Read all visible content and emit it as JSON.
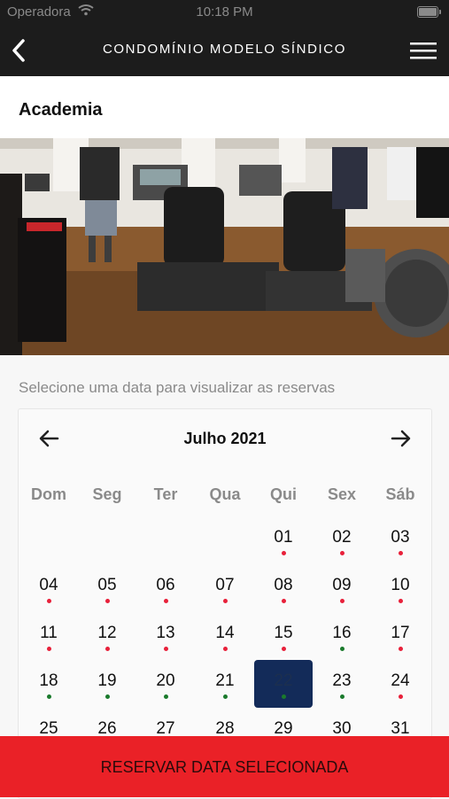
{
  "status_bar": {
    "carrier": "Operadora",
    "time": "10:18 PM"
  },
  "nav": {
    "title": "CONDOMÍNIO MODELO SÍNDICO",
    "back_icon": "chevron-left-icon",
    "menu_icon": "hamburger-menu-icon"
  },
  "page": {
    "section_title": "Academia",
    "hint": "Selecione uma data para visualizar as reservas"
  },
  "calendar": {
    "month_label": "Julho 2021",
    "weekdays": [
      "Dom",
      "Seg",
      "Ter",
      "Qua",
      "Qui",
      "Sex",
      "Sáb"
    ],
    "days": [
      {
        "label": "01",
        "status": "unavailable"
      },
      {
        "label": "02",
        "status": "unavailable"
      },
      {
        "label": "03",
        "status": "unavailable"
      },
      {
        "label": "04",
        "status": "unavailable"
      },
      {
        "label": "05",
        "status": "unavailable"
      },
      {
        "label": "06",
        "status": "unavailable"
      },
      {
        "label": "07",
        "status": "unavailable"
      },
      {
        "label": "08",
        "status": "unavailable"
      },
      {
        "label": "09",
        "status": "unavailable"
      },
      {
        "label": "10",
        "status": "unavailable"
      },
      {
        "label": "11",
        "status": "unavailable"
      },
      {
        "label": "12",
        "status": "unavailable"
      },
      {
        "label": "13",
        "status": "unavailable"
      },
      {
        "label": "14",
        "status": "unavailable"
      },
      {
        "label": "15",
        "status": "unavailable"
      },
      {
        "label": "16",
        "status": "available"
      },
      {
        "label": "17",
        "status": "unavailable"
      },
      {
        "label": "18",
        "status": "available"
      },
      {
        "label": "19",
        "status": "available"
      },
      {
        "label": "20",
        "status": "available"
      },
      {
        "label": "21",
        "status": "available"
      },
      {
        "label": "22",
        "status": "available",
        "selected": true
      },
      {
        "label": "23",
        "status": "available"
      },
      {
        "label": "24",
        "status": "unavailable"
      },
      {
        "label": "25",
        "status": "none"
      },
      {
        "label": "26",
        "status": "none"
      },
      {
        "label": "27",
        "status": "none"
      },
      {
        "label": "28",
        "status": "none"
      },
      {
        "label": "29",
        "status": "none"
      },
      {
        "label": "30",
        "status": "none"
      },
      {
        "label": "31",
        "status": "none"
      }
    ],
    "first_weekday": 4,
    "colors": {
      "available": "#1a7a2c",
      "unavailable": "#e8203a",
      "selected": "#132b59"
    }
  },
  "footer": {
    "reserve_label": "RESERVAR DATA SELECIONADA",
    "button_color": "#ea2127"
  }
}
